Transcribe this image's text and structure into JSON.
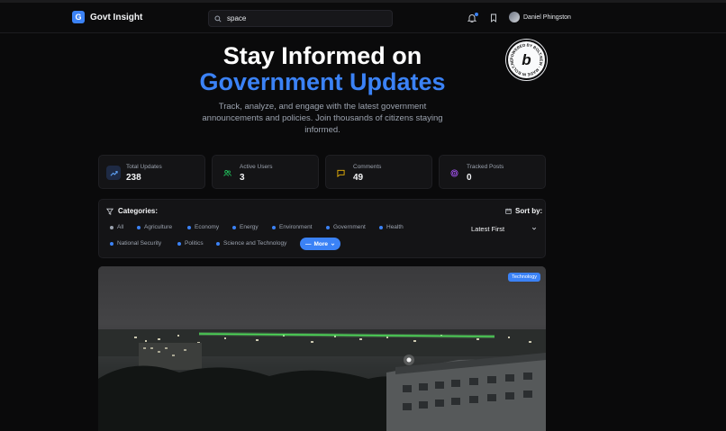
{
  "header": {
    "brand_letter": "G",
    "brand_name": "Govt Insight",
    "search_value": "space",
    "user_name": "Daniel Phingston"
  },
  "badge": {
    "ring_text": "POWERED BY BOLT.NEW · MADE IN BOLT.NEW · ",
    "letter": "b"
  },
  "hero": {
    "title_line1": "Stay Informed on",
    "title_line2": "Government Updates",
    "subtitle": "Track, analyze, and engage with the latest government announcements and policies. Join thousands of citizens staying informed."
  },
  "stats": [
    {
      "label": "Total Updates",
      "value": "238",
      "icon": "trending-up-icon"
    },
    {
      "label": "Active Users",
      "value": "3",
      "icon": "users-icon"
    },
    {
      "label": "Comments",
      "value": "49",
      "icon": "message-icon"
    },
    {
      "label": "Tracked Posts",
      "value": "0",
      "icon": "target-icon"
    }
  ],
  "filters": {
    "categories_label": "Categories:",
    "categories": [
      "All",
      "Agriculture",
      "Economy",
      "Energy",
      "Environment",
      "Government",
      "Health",
      "National Security",
      "Politics",
      "Science and Technology"
    ],
    "more_label": "More",
    "sort_label": "Sort by:",
    "sort_value": "Latest First"
  },
  "card": {
    "tag": "Technology"
  },
  "colors": {
    "accent": "#3b82f6",
    "background": "#0a0a0b",
    "panel": "#141416"
  }
}
